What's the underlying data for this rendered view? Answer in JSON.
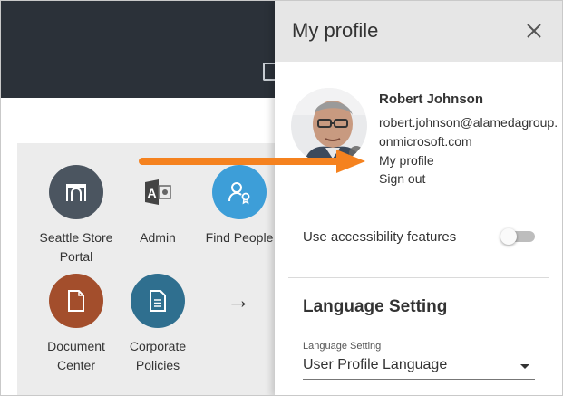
{
  "app": {
    "tiles": [
      {
        "label": "Seattle Store Portal",
        "icon": "archway-icon",
        "color": "#4b5560"
      },
      {
        "label": "Admin",
        "icon": "admin-access-icon",
        "color": "#ffffff"
      },
      {
        "label": "Find People",
        "icon": "person-badge-icon",
        "color": "#3d9ed8"
      },
      {
        "label": "Document Center",
        "icon": "document-icon",
        "color": "#a34e2c"
      },
      {
        "label": "Corporate Policies",
        "icon": "document-lines-icon",
        "color": "#2f6f8f"
      }
    ],
    "more_arrow": "→"
  },
  "panel": {
    "title": "My profile",
    "close_icon": "close-icon",
    "user": {
      "name": "Robert Johnson",
      "email": "robert.johnson@alamedagroup.onmicrosoft.com"
    },
    "links": {
      "my_profile": "My profile",
      "sign_out": "Sign out"
    },
    "accessibility": {
      "label": "Use accessibility features",
      "enabled": false
    },
    "language": {
      "heading": "Language Setting",
      "field_label": "Language Setting",
      "selected": "User Profile Language"
    }
  },
  "colors": {
    "annotation_arrow": "#f5821f",
    "topbar": "#2b3139",
    "panel_header": "#e6e6e6"
  }
}
